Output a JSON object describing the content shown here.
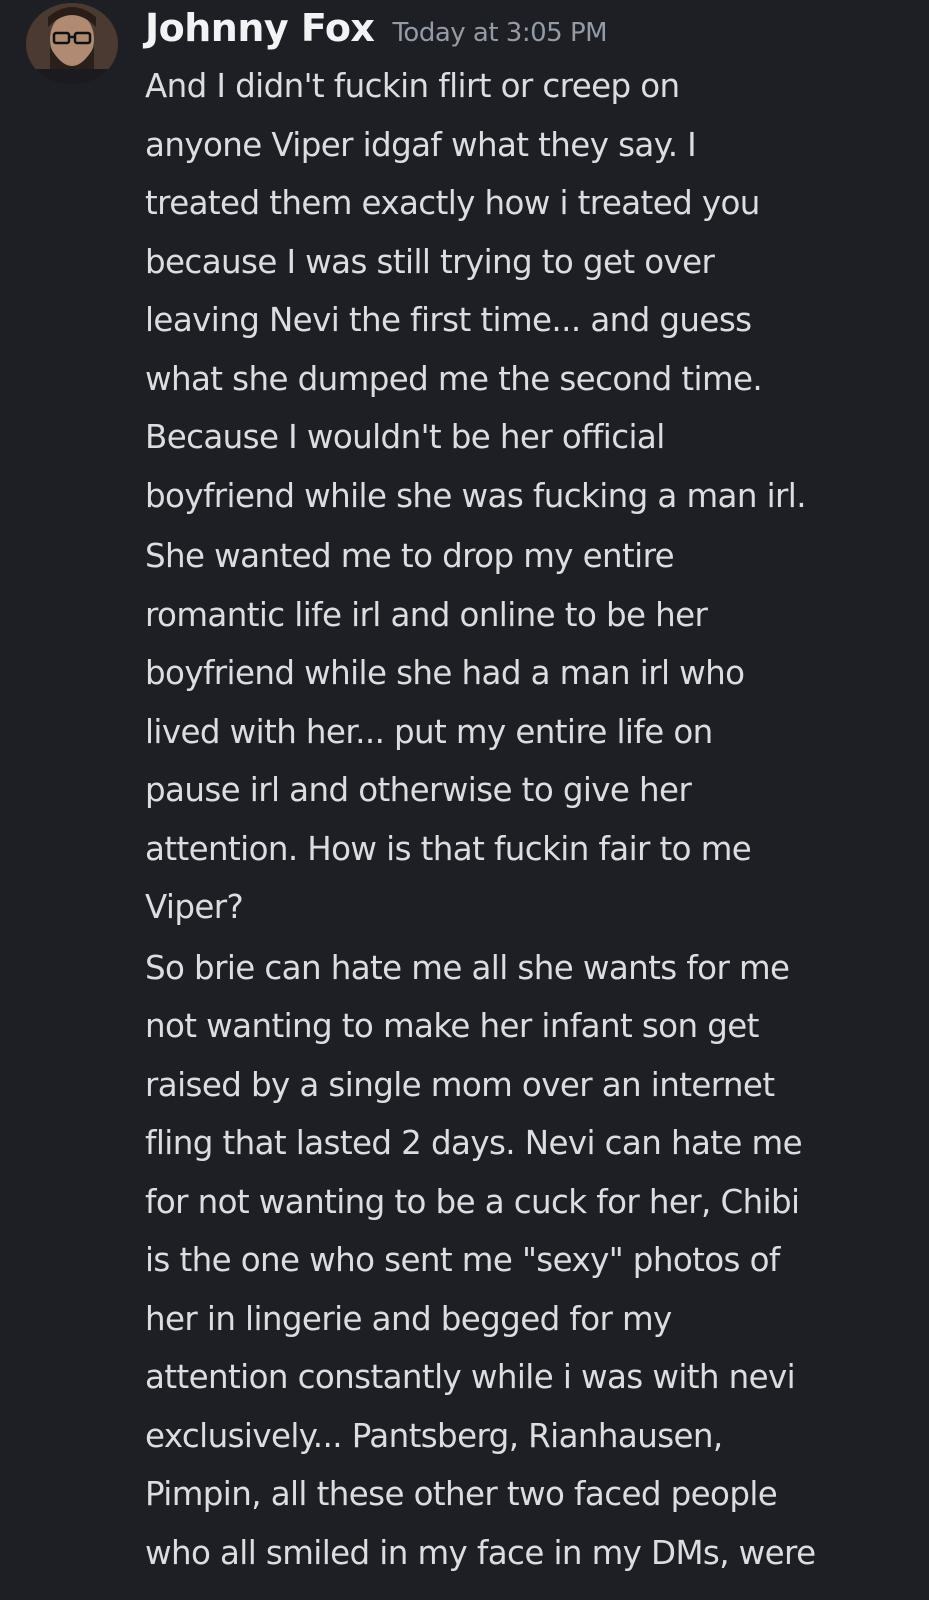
{
  "message": {
    "username": "Johnny Fox",
    "timestamp": "Today at 3:05 PM",
    "paragraphs": [
      [
        "And I didn't fuckin flirt or creep on",
        "anyone Viper idgaf what they say. I",
        "treated them exactly how i treated you",
        "because I was still trying to get over",
        "leaving Nevi the first time... and guess",
        "what she dumped me the second time.",
        "Because I wouldn't be her official",
        "boyfriend while she was fucking a man irl."
      ],
      [
        "She wanted me to drop my entire",
        "romantic life irl and online to be her",
        "boyfriend while she had a man irl who",
        "lived with her... put my entire life on",
        "pause irl and otherwise to give her",
        "attention. How is that fuckin fair to me",
        "Viper?"
      ],
      [
        "So brie can hate me all she wants for me",
        "not wanting to make her infant son get",
        "raised by a single mom over an internet",
        "fling that lasted 2 days. Nevi can hate me",
        "for not wanting to be a cuck for her, Chibi",
        "is the one who sent me \"sexy\" photos of",
        "her in lingerie and begged for my",
        "attention constantly while i was with nevi",
        "exclusively... Pantsberg, Rianhausen,",
        "Pimpin, all these other two faced people",
        "who all smiled in my face in my DMs, were"
      ]
    ]
  },
  "colors": {
    "background": "#1e1f25",
    "username": "#f2f3f5",
    "timestamp": "#949ba4",
    "text": "#dbdee1"
  }
}
